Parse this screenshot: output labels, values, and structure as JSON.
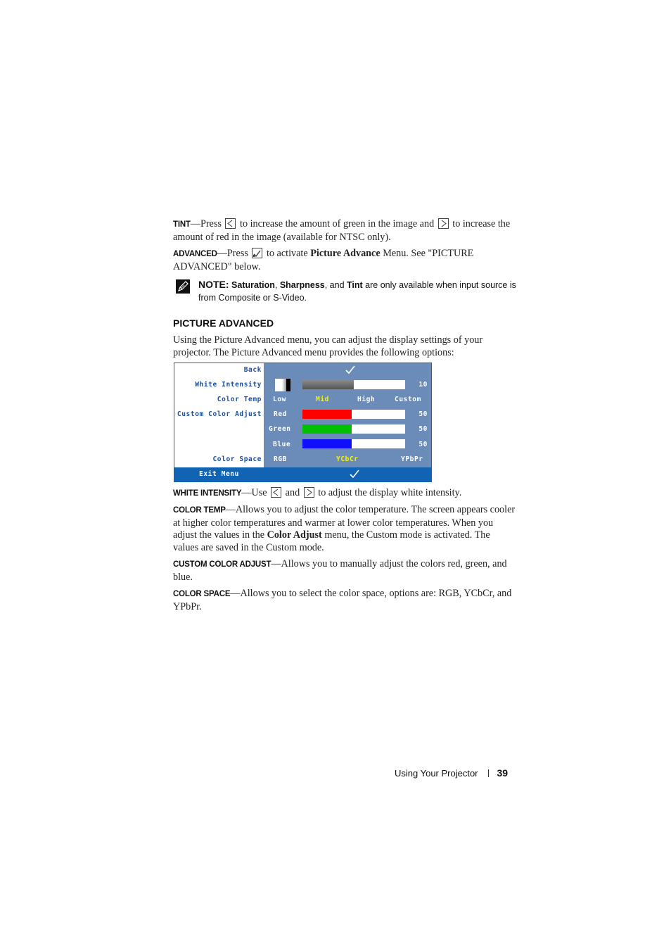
{
  "tint": {
    "term": "Tint",
    "dash": "—",
    "text1": "Press",
    "text2": "to increase the amount of green in the image and",
    "text3": "to increase the amount of red in the image (available for NTSC only).",
    "left_key_icon": "left-arrow-key-icon",
    "right_key_icon": "right-arrow-key-icon"
  },
  "advanced": {
    "term": "Advanced",
    "dash": "—",
    "text1": "Press",
    "text2": "to activate",
    "bold": "Picture Advance",
    "text3": "Menu. See \"PICTURE ADVANCED\" below.",
    "key_icon": "enter-checkmark-key-icon"
  },
  "note": {
    "icon": "pencil-note-icon",
    "label": "NOTE:",
    "b1": "Saturation",
    "sep1": ", ",
    "b2": "Sharpness",
    "sep2": ", and ",
    "b3": "Tint",
    "rest": " are only available when input source is from Composite or S-Video."
  },
  "section": {
    "heading": "PICTURE ADVANCED",
    "intro": "Using the Picture Advanced menu, you can adjust the display settings of your projector. The Picture Advanced menu provides the following options:"
  },
  "osd": {
    "labels": {
      "back": "Back",
      "white_intensity": "White Intensity",
      "color_temp": "Color Temp",
      "custom_color_adjust": "Custom Color Adjust",
      "color_space": "Color Space",
      "exit": "Exit Menu"
    },
    "back_icon": "checkmark-icon",
    "exit_icon": "checkmark-icon",
    "white_intensity": {
      "value": "10",
      "fraction": 0.5
    },
    "color_temp": {
      "options": [
        "Low",
        "Mid",
        "High",
        "Custom"
      ],
      "selected": "Mid"
    },
    "channels": [
      {
        "name": "Red",
        "value": "50",
        "fraction": 0.48,
        "color": "#ff0000"
      },
      {
        "name": "Green",
        "value": "50",
        "fraction": 0.48,
        "color": "#00c000"
      },
      {
        "name": "Blue",
        "value": "50",
        "fraction": 0.48,
        "color": "#1010ff"
      }
    ],
    "color_space": {
      "options": [
        "RGB",
        "YCbCr",
        "YPbPr"
      ],
      "selected": "YCbCr"
    },
    "colors": {
      "panel": "#6b8cb8",
      "label": "#1a4f9a",
      "selected": "#f5f500",
      "exit_bar": "#1163b4"
    }
  },
  "white_intensity": {
    "term": "White Intensity",
    "dash": "—",
    "text1": "Use",
    "text2": "and",
    "text3": "to adjust the display white intensity."
  },
  "color_temp": {
    "term": "Color Temp",
    "dash": "—",
    "text1": "Allows you to adjust the color temperature. The screen appears cooler at higher color temperatures and warmer at lower color temperatures. When you adjust the values in the",
    "bold": "Color Adjust",
    "text2": "menu, the Custom mode is activated. The values are saved in the Custom mode."
  },
  "custom_color_adjust": {
    "term": "Custom Color Adjust",
    "dash": "—",
    "text": "Allows you to manually adjust the colors red, green, and blue."
  },
  "color_space": {
    "term": "Color Space",
    "dash": "—",
    "text": "Allows you to select the color space, options are: RGB, YCbCr, and YPbPr."
  },
  "footer": {
    "section": "Using Your Projector",
    "page": "39"
  }
}
